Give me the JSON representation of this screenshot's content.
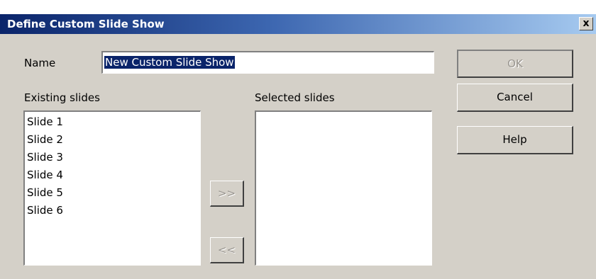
{
  "window": {
    "title": "Define Custom Slide Show",
    "close_label": "x"
  },
  "name_field": {
    "label": "Name",
    "value": "New Custom Slide Show"
  },
  "existing_slides": {
    "label": "Existing slides",
    "items": [
      "Slide 1",
      "Slide 2",
      "Slide 3",
      "Slide 4",
      "Slide 5",
      "Slide 6"
    ]
  },
  "selected_slides": {
    "label": "Selected slides",
    "items": []
  },
  "buttons": {
    "ok": "OK",
    "cancel": "Cancel",
    "help": "Help",
    "add": ">>",
    "remove": "<<"
  }
}
